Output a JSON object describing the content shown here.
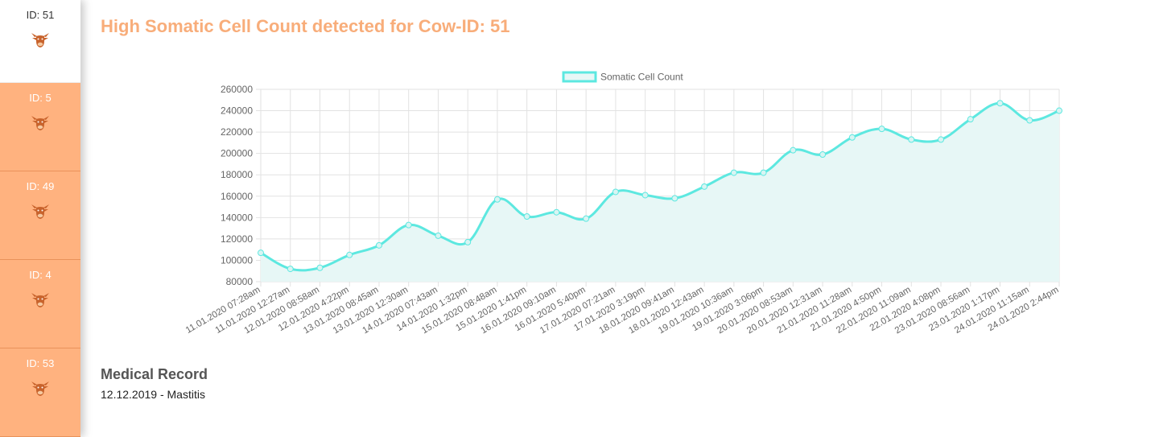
{
  "sidebar": {
    "items": [
      {
        "label": "ID: 51",
        "active": true
      },
      {
        "label": "ID: 5",
        "active": false
      },
      {
        "label": "ID: 49",
        "active": false
      },
      {
        "label": "ID: 4",
        "active": false
      },
      {
        "label": "ID: 53",
        "active": false
      }
    ],
    "icon": "cow-head-icon",
    "icon_color": "#c8632c"
  },
  "main": {
    "title": "High Somatic Cell Count detected for Cow-ID: 51",
    "title_color": "#f8ad7a",
    "medical_record": {
      "heading": "Medical Record",
      "entries": [
        "12.12.2019 - Mastitis"
      ]
    }
  },
  "chart_data": {
    "type": "line",
    "legend_position": "top",
    "grid": true,
    "line_color": "#5de8e0",
    "fill_color": "#e7f7f6",
    "ylim": [
      80000,
      260000
    ],
    "ytick_step": 20000,
    "categories": [
      "11.01.2020 07:28am",
      "11.01.2020 12:27am",
      "12.01.2020 08:58am",
      "12.01.2020 4:22pm",
      "13.01.2020 08:45am",
      "13.01.2020 12:30am",
      "14.01.2020 07:43am",
      "14.01.2020 1:32pm",
      "15.01.2020 08:48am",
      "15.01.2020 1:41pm",
      "16.01.2020 09:10am",
      "16.01.2020 5:40pm",
      "17.01.2020 07:21am",
      "17.01.2020 3:19pm",
      "18.01.2020 09:41am",
      "18.01.2020 12:43am",
      "19.01.2020 10:36am",
      "19.01.2020 3:06pm",
      "20.01.2020 08:53am",
      "20.01.2020 12:31am",
      "21.01.2020 11:28am",
      "21.01.2020 4:50pm",
      "22.01.2020 11:09am",
      "22.01.2020 4:08pm",
      "23.01.2020 08:56am",
      "23.01.2020 1:17pm",
      "24.01.2020 11:15am",
      "24.01.2020 2:44pm"
    ],
    "series": [
      {
        "name": "Somatic Cell Count",
        "values": [
          107000,
          92000,
          93000,
          105000,
          114000,
          133000,
          123000,
          117000,
          157000,
          141000,
          145000,
          139000,
          164000,
          161000,
          158000,
          169000,
          182000,
          182000,
          203000,
          199000,
          215000,
          223000,
          213000,
          213000,
          232000,
          247000,
          231000,
          240000
        ]
      }
    ]
  }
}
